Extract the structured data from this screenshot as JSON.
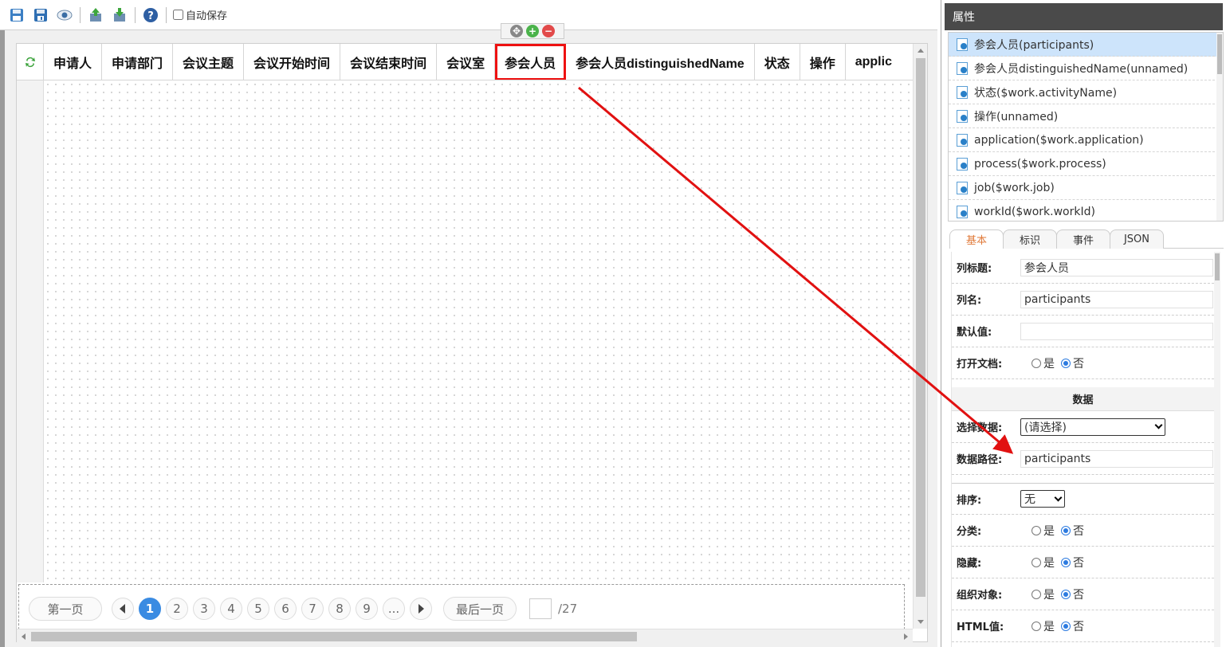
{
  "toolbar": {
    "icons": [
      "save-icon",
      "save-as-icon",
      "preview-icon",
      "import-icon",
      "export-icon",
      "help-icon"
    ],
    "autosave_label": "自动保存",
    "autosave_checked": false
  },
  "columns": [
    {
      "label": "申请人"
    },
    {
      "label": "申请部门"
    },
    {
      "label": "会议主题"
    },
    {
      "label": "会议开始时间"
    },
    {
      "label": "会议结束时间"
    },
    {
      "label": "会议室"
    },
    {
      "label": "参会人员",
      "selected": true
    },
    {
      "label": "参会人员distinguishedName"
    },
    {
      "label": "状态"
    },
    {
      "label": "操作"
    },
    {
      "label": "applic"
    }
  ],
  "pager": {
    "first_label": "第一页",
    "last_label": "最后一页",
    "pages": [
      "1",
      "2",
      "3",
      "4",
      "5",
      "6",
      "7",
      "8",
      "9",
      "..."
    ],
    "current_page": "1",
    "total_label": "/27"
  },
  "properties_panel": {
    "title": "属性",
    "tree_items": [
      {
        "label": "参会人员(participants)",
        "active": true
      },
      {
        "label": "参会人员distinguishedName(unnamed)"
      },
      {
        "label": "状态($work.activityName)"
      },
      {
        "label": "操作(unnamed)"
      },
      {
        "label": "application($work.application)"
      },
      {
        "label": "process($work.process)"
      },
      {
        "label": "job($work.job)"
      },
      {
        "label": "workId($work.workId)"
      }
    ],
    "tabs": [
      "基本",
      "标识",
      "事件",
      "JSON"
    ],
    "active_tab": "基本",
    "fields": {
      "column_title_label": "列标题:",
      "column_title_value": "参会人员",
      "column_name_label": "列名:",
      "column_name_value": "participants",
      "default_label": "默认值:",
      "default_value": "",
      "open_doc_label": "打开文档:",
      "data_section": "数据",
      "select_data_label": "选择数据:",
      "select_data_value": "(请选择)",
      "data_path_label": "数据路径:",
      "data_path_value": "participants",
      "sort_label": "排序:",
      "sort_value": "无",
      "category_label": "分类:",
      "hidden_label": "隐藏:",
      "org_label": "组织对象:",
      "html_label": "HTML值:",
      "yes": "是",
      "no": "否"
    }
  },
  "colors": {
    "highlight_red": "#e11111",
    "active_page_blue": "#3a8be2",
    "tree_active_bg": "#cde4fb",
    "panel_header_bg": "#4a4a4a"
  }
}
